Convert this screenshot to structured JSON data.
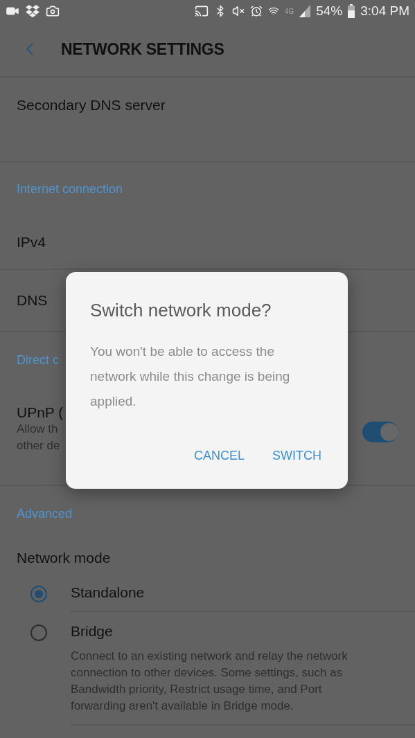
{
  "status_bar": {
    "network_type": "4G",
    "battery": "54%",
    "time": "3:04 PM"
  },
  "toolbar": {
    "title": "NETWORK SETTINGS"
  },
  "sections": [
    {
      "items": [
        {
          "kind": "plain",
          "title": "Secondary DNS server"
        }
      ]
    },
    {
      "header": "Internet connection",
      "items": [
        {
          "kind": "plain",
          "title": "IPv4"
        },
        {
          "kind": "plain",
          "title": "DNS"
        }
      ]
    },
    {
      "header": "Direct c",
      "items": [
        {
          "kind": "toggle",
          "title": "UPnP (",
          "description": [
            "Allow th",
            "other de"
          ],
          "on": true
        }
      ]
    },
    {
      "header": "Advanced",
      "items": [
        {
          "kind": "radio_group",
          "title": "Network mode",
          "options": [
            {
              "label": "Standalone",
              "selected": true
            },
            {
              "label": "Bridge",
              "selected": false,
              "description": "Connect to an existing network and relay the network connection to other devices. Some settings, such as Bandwidth priority, Restrict usage time, and Port forwarding aren't available in Bridge mode."
            }
          ]
        }
      ]
    }
  ],
  "dialog": {
    "title": "Switch network mode?",
    "message": "You won't be able to access the network while this change is being applied.",
    "buttons": [
      "CANCEL",
      "SWITCH"
    ]
  }
}
